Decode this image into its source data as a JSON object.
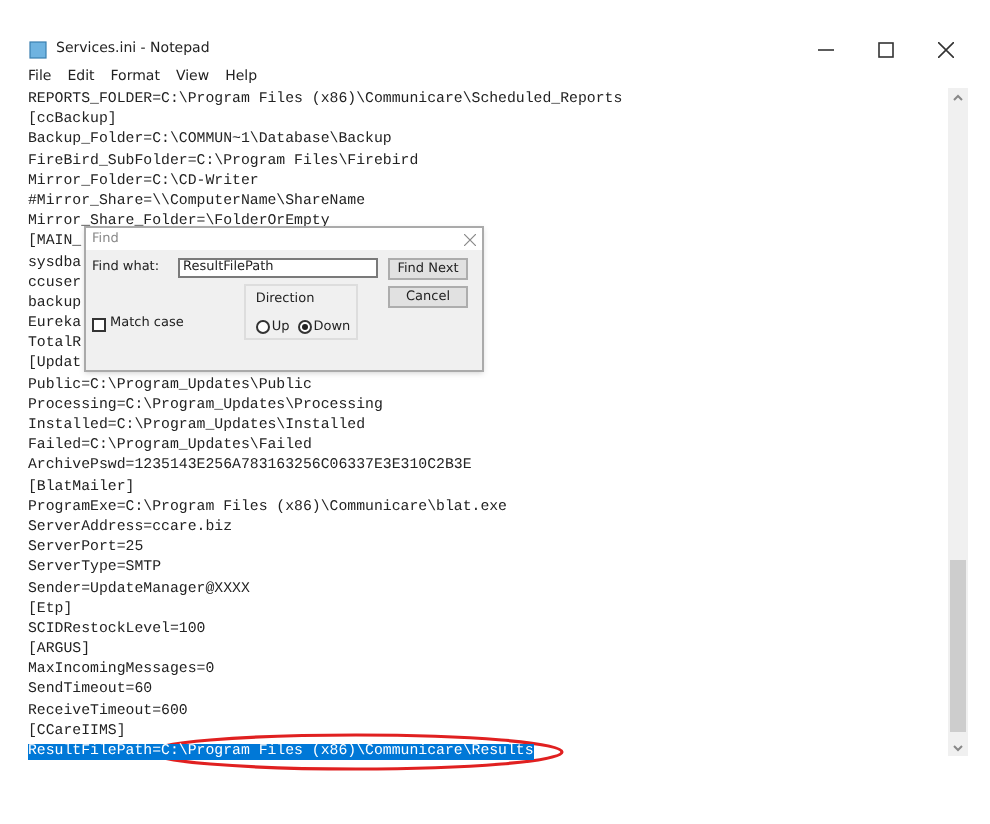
{
  "window": {
    "title": "Services.ini - Notepad"
  },
  "menu": [
    "File",
    "Edit",
    "Format",
    "View",
    "Help"
  ],
  "lines": [
    {
      "text": "REPORTS_FOLDER=C:\\Program Files (x86)\\Communicare\\Scheduled_Reports",
      "selected": false
    },
    {
      "text": "[ccBackup]",
      "selected": false
    },
    {
      "text": "Backup_Folder=C:\\COMMUN~1\\Database\\Backup",
      "selected": false
    },
    {
      "text": "FireBird_SubFolder=C:\\Program Files\\Firebird",
      "selected": false
    },
    {
      "text": "Mirror_Folder=C:\\CD-Writer",
      "selected": false
    },
    {
      "text": "#Mirror_Share=\\\\ComputerName\\ShareName",
      "selected": false
    },
    {
      "text": "Mirror_Share_Folder=\\FolderOrEmpty",
      "selected": false
    },
    {
      "text": "[MAIN_",
      "selected": false
    },
    {
      "text": "sysdba",
      "selected": false
    },
    {
      "text": "ccuser",
      "selected": false
    },
    {
      "text": "backup",
      "selected": false
    },
    {
      "text": "Eureka",
      "selected": false
    },
    {
      "text": "TotalR",
      "selected": false
    },
    {
      "text": "[Updat",
      "selected": false
    },
    {
      "text": "Public=C:\\Program_Updates\\Public",
      "selected": false
    },
    {
      "text": "Processing=C:\\Program_Updates\\Processing",
      "selected": false
    },
    {
      "text": "Installed=C:\\Program_Updates\\Installed",
      "selected": false
    },
    {
      "text": "Failed=C:\\Program_Updates\\Failed",
      "selected": false
    },
    {
      "text": "ArchivePswd=1235143E256A783163256C06337E3E310C2B3E",
      "selected": false
    },
    {
      "text": "[BlatMailer]",
      "selected": false
    },
    {
      "text": "ProgramExe=C:\\Program Files (x86)\\Communicare\\blat.exe",
      "selected": false
    },
    {
      "text": "ServerAddress=ccare.biz",
      "selected": false
    },
    {
      "text": "ServerPort=25",
      "selected": false
    },
    {
      "text": "ServerType=SMTP",
      "selected": false
    },
    {
      "text": "Sender=UpdateManager@XXXX",
      "selected": false
    },
    {
      "text": "[Etp]",
      "selected": false
    },
    {
      "text": "SCIDRestockLevel=100",
      "selected": false
    },
    {
      "text": "[ARGUS]",
      "selected": false
    },
    {
      "text": "MaxIncomingMessages=0",
      "selected": false
    },
    {
      "text": "SendTimeout=60",
      "selected": false
    },
    {
      "text": "ReceiveTimeout=600",
      "selected": false
    },
    {
      "text": "[CCareIIMS]",
      "selected": false
    },
    {
      "text": "ResultFilePath=C:\\Program Files (x86)\\Communicare\\Results",
      "selected": true
    }
  ],
  "find_dialog": {
    "title": "Find",
    "find_what_label": "Find what:",
    "find_what_value": "ResultFilePath",
    "find_next_button": "Find Next",
    "cancel_button": "Cancel",
    "direction_label": "Direction",
    "directions": [
      {
        "label": "Up",
        "selected": false
      },
      {
        "label": "Down",
        "selected": true
      }
    ],
    "match_case": {
      "label": "Match case",
      "checked": false
    }
  }
}
